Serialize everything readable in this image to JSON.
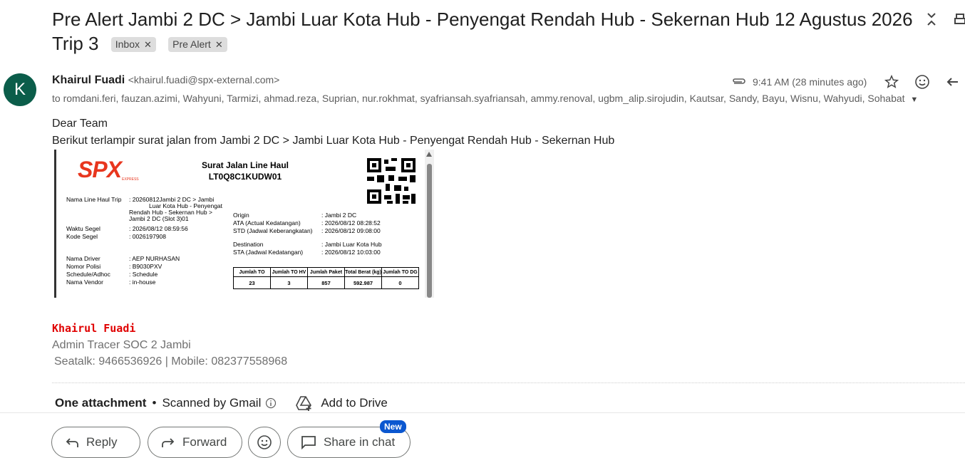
{
  "email": {
    "subject": "Pre Alert Jambi 2 DC > Jambi Luar Kota Hub - Penyengat Rendah Hub - Sekernan Hub 12 Agustus 2026 Trip 3",
    "labels": [
      "Inbox",
      "Pre Alert"
    ],
    "sender_initial": "K",
    "sender_name": "Khairul Fuadi",
    "sender_email": "<khairul.fuadi@spx-external.com>",
    "recipients": "to romdani.feri, fauzan.azimi, Wahyuni, Tarmizi, ahmad.reza, Suprian, nur.rokhmat, syafriansah.syafriansah, ammy.renoval, ugbm_alip.sirojudin, Kautsar, Sandy, Bayu, Wisnu, Wahyudi, Sohabat",
    "time": "9:41 AM (28 minutes ago)",
    "greeting": "Dear Team",
    "body_line": "Berikut terlampir surat jalan from Jambi 2 DC > Jambi Luar Kota Hub - Penyengat Rendah Hub - Sekernan Hub"
  },
  "document": {
    "logo_text": "SPX",
    "logo_sub": "EXPRESS",
    "title_line1": "Surat Jalan Line Haul",
    "title_line2": "LT0Q8C1KUDW01",
    "left_fields": [
      {
        "k": "Nama Line Haul Trip",
        "v": ": 20260812Jambi 2 DC > Jambi"
      },
      {
        "k": "",
        "v": "Luar Kota Hub - Penyengat"
      },
      {
        "k": "",
        "v": "Rendah Hub - Sekernan Hub >"
      },
      {
        "k": "",
        "v": "Jambi 2 DC (Slot 3)01"
      },
      {
        "k": "Waktu Segel",
        "v": ": 2026/08/12 08:59:56"
      },
      {
        "k": "Kode Segel",
        "v": ": 0026197908"
      },
      {
        "k": "Nama Driver",
        "v": ": AEP NURHASAN"
      },
      {
        "k": "Nomor Polisi",
        "v": ": B9030PXV"
      },
      {
        "k": "Schedule/Adhoc",
        "v": ": Schedule"
      },
      {
        "k": "Nama Vendor",
        "v": ": in-house"
      }
    ],
    "right_fields": [
      {
        "k": "Origin",
        "v": ": Jambi 2 DC"
      },
      {
        "k": "ATA (Actual Kedatangan)",
        "v": ": 2026/08/12 08:28:52"
      },
      {
        "k": "STD (Jadwal Keberangkatan)",
        "v": ": 2026/08/12 09:08:00"
      },
      {
        "k": "Destination",
        "v": ": Jambi Luar Kota Hub"
      },
      {
        "k": "STA (Jadwal Kedatangan)",
        "v": ": 2026/08/12 10:03:00"
      }
    ],
    "table_headers": [
      "Jumlah TO",
      "Jumlah TO HV",
      "Jumlah Paket",
      "Total Berat (kg)",
      "Jumlah TO DG"
    ],
    "table_values": [
      "23",
      "3",
      "857",
      "592.987",
      "0"
    ]
  },
  "signature": {
    "name": "Khairul Fuadi",
    "role": "Admin Tracer SOC 2 Jambi",
    "contact": "Seatalk: 9466536926 | Mobile: 082377558968"
  },
  "attachments": {
    "count_label": "One attachment",
    "scanned": "Scanned by Gmail",
    "add_to_drive": "Add to Drive"
  },
  "actions": {
    "reply": "Reply",
    "forward": "Forward",
    "share_in_chat": "Share in chat",
    "new_badge": "New"
  }
}
